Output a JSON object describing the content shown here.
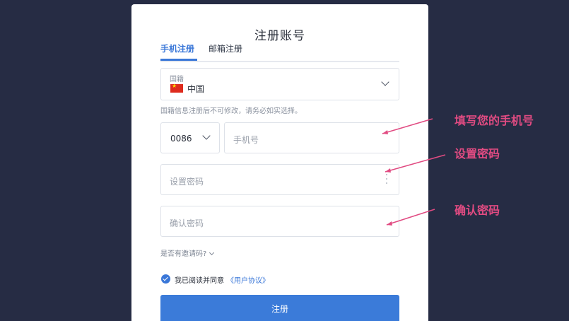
{
  "form": {
    "title": "注册账号",
    "tabs": [
      {
        "label": "手机注册",
        "active": true
      },
      {
        "label": "邮箱注册",
        "active": false
      }
    ],
    "country": {
      "label": "国籍",
      "value": "中国",
      "flag_icon": "china-flag-icon",
      "hint": "国籍信息注册后不可修改，请务必如实选择。"
    },
    "phone": {
      "code": "0086",
      "placeholder": "手机号"
    },
    "password": {
      "placeholder": "设置密码"
    },
    "confirm_password": {
      "placeholder": "确认密码"
    },
    "invite_code_toggle": "是否有邀请码?",
    "agreement": {
      "checked": true,
      "text": "我已阅读并同意",
      "link": "《用户协议》"
    },
    "submit_label": "注册"
  },
  "annotations": {
    "phone": "填写您的手机号",
    "password": "设置密码",
    "confirm": "确认密码",
    "color": "#e14b82"
  },
  "colors": {
    "background": "#262c44",
    "accent": "#3a77d8",
    "card": "#ffffff"
  }
}
